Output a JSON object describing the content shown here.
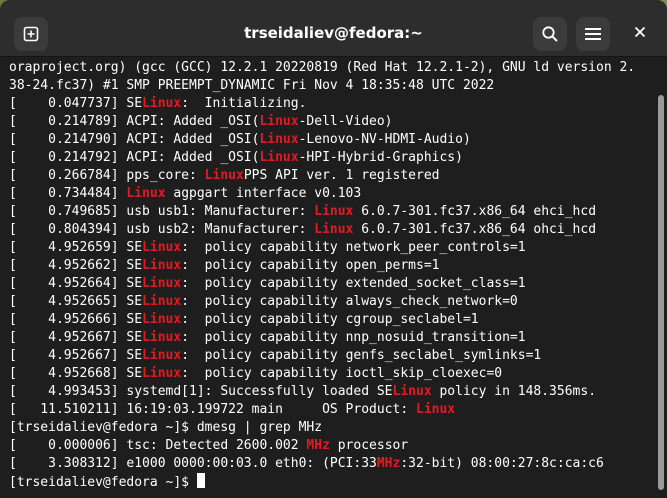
{
  "window": {
    "title": "trseidaliev@fedora:~"
  },
  "icons": {
    "new_tab": "new-tab-icon",
    "search": "search-icon",
    "menu": "hamburger-menu-icon",
    "close": "close-icon"
  },
  "colors": {
    "highlight": "#e01b24",
    "background": "#1e1e1e",
    "titlebar": "#2d2d2d"
  },
  "terminal": {
    "lines": [
      [
        {
          "t": "oraproject.org) (gcc (GCC) 12.2.1 20220819 (Red Hat 12.2.1-2), GNU ld version 2."
        }
      ],
      [
        {
          "t": "38-24.fc37) #1 SMP PREEMPT_DYNAMIC Fri Nov 4 18:35:48 UTC 2022"
        }
      ],
      [
        {
          "t": "[    0.047737] SE"
        },
        {
          "t": "Linux",
          "hl": true
        },
        {
          "t": ":  Initializing."
        }
      ],
      [
        {
          "t": "[    0.214789] ACPI: Added _OSI("
        },
        {
          "t": "Linux",
          "hl": true
        },
        {
          "t": "-Dell-Video)"
        }
      ],
      [
        {
          "t": "[    0.214790] ACPI: Added _OSI("
        },
        {
          "t": "Linux",
          "hl": true
        },
        {
          "t": "-Lenovo-NV-HDMI-Audio)"
        }
      ],
      [
        {
          "t": "[    0.214792] ACPI: Added _OSI("
        },
        {
          "t": "Linux",
          "hl": true
        },
        {
          "t": "-HPI-Hybrid-Graphics)"
        }
      ],
      [
        {
          "t": "[    0.266784] pps_core: "
        },
        {
          "t": "Linux",
          "hl": true
        },
        {
          "t": "PPS API ver. 1 registered"
        }
      ],
      [
        {
          "t": "[    0.734484] "
        },
        {
          "t": "Linux",
          "hl": true
        },
        {
          "t": " agpgart interface v0.103"
        }
      ],
      [
        {
          "t": "[    0.749685] usb usb1: Manufacturer: "
        },
        {
          "t": "Linux",
          "hl": true
        },
        {
          "t": " 6.0.7-301.fc37.x86_64 ehci_hcd"
        }
      ],
      [
        {
          "t": "[    0.804394] usb usb2: Manufacturer: "
        },
        {
          "t": "Linux",
          "hl": true
        },
        {
          "t": " 6.0.7-301.fc37.x86_64 ohci_hcd"
        }
      ],
      [
        {
          "t": "[    4.952659] SE"
        },
        {
          "t": "Linux",
          "hl": true
        },
        {
          "t": ":  policy capability network_peer_controls=1"
        }
      ],
      [
        {
          "t": "[    4.952662] SE"
        },
        {
          "t": "Linux",
          "hl": true
        },
        {
          "t": ":  policy capability open_perms=1"
        }
      ],
      [
        {
          "t": "[    4.952664] SE"
        },
        {
          "t": "Linux",
          "hl": true
        },
        {
          "t": ":  policy capability extended_socket_class=1"
        }
      ],
      [
        {
          "t": "[    4.952665] SE"
        },
        {
          "t": "Linux",
          "hl": true
        },
        {
          "t": ":  policy capability always_check_network=0"
        }
      ],
      [
        {
          "t": "[    4.952666] SE"
        },
        {
          "t": "Linux",
          "hl": true
        },
        {
          "t": ":  policy capability cgroup_seclabel=1"
        }
      ],
      [
        {
          "t": "[    4.952667] SE"
        },
        {
          "t": "Linux",
          "hl": true
        },
        {
          "t": ":  policy capability nnp_nosuid_transition=1"
        }
      ],
      [
        {
          "t": "[    4.952667] SE"
        },
        {
          "t": "Linux",
          "hl": true
        },
        {
          "t": ":  policy capability genfs_seclabel_symlinks=1"
        }
      ],
      [
        {
          "t": "[    4.952668] SE"
        },
        {
          "t": "Linux",
          "hl": true
        },
        {
          "t": ":  policy capability ioctl_skip_cloexec=0"
        }
      ],
      [
        {
          "t": "[    4.993453] systemd[1]: Successfully loaded SE"
        },
        {
          "t": "Linux",
          "hl": true
        },
        {
          "t": " policy in 148.356ms."
        }
      ],
      [
        {
          "t": "[   11.510211] 16:19:03.199722 main     OS Product: "
        },
        {
          "t": "Linux",
          "hl": true
        }
      ],
      [
        {
          "t": "[trseidaliev@fedora ~]$ dmesg | grep MHz"
        }
      ],
      [
        {
          "t": "[    0.000006] tsc: Detected 2600.002 "
        },
        {
          "t": "MHz",
          "hl": true
        },
        {
          "t": " processor"
        }
      ],
      [
        {
          "t": "[    3.308312] e1000 0000:00:03.0 eth0: (PCI:33"
        },
        {
          "t": "MHz",
          "hl": true
        },
        {
          "t": ":32-bit) 08:00:27:8c:ca:c6"
        }
      ],
      [
        {
          "t": "[trseidaliev@fedora ~]$ "
        }
      ]
    ]
  }
}
